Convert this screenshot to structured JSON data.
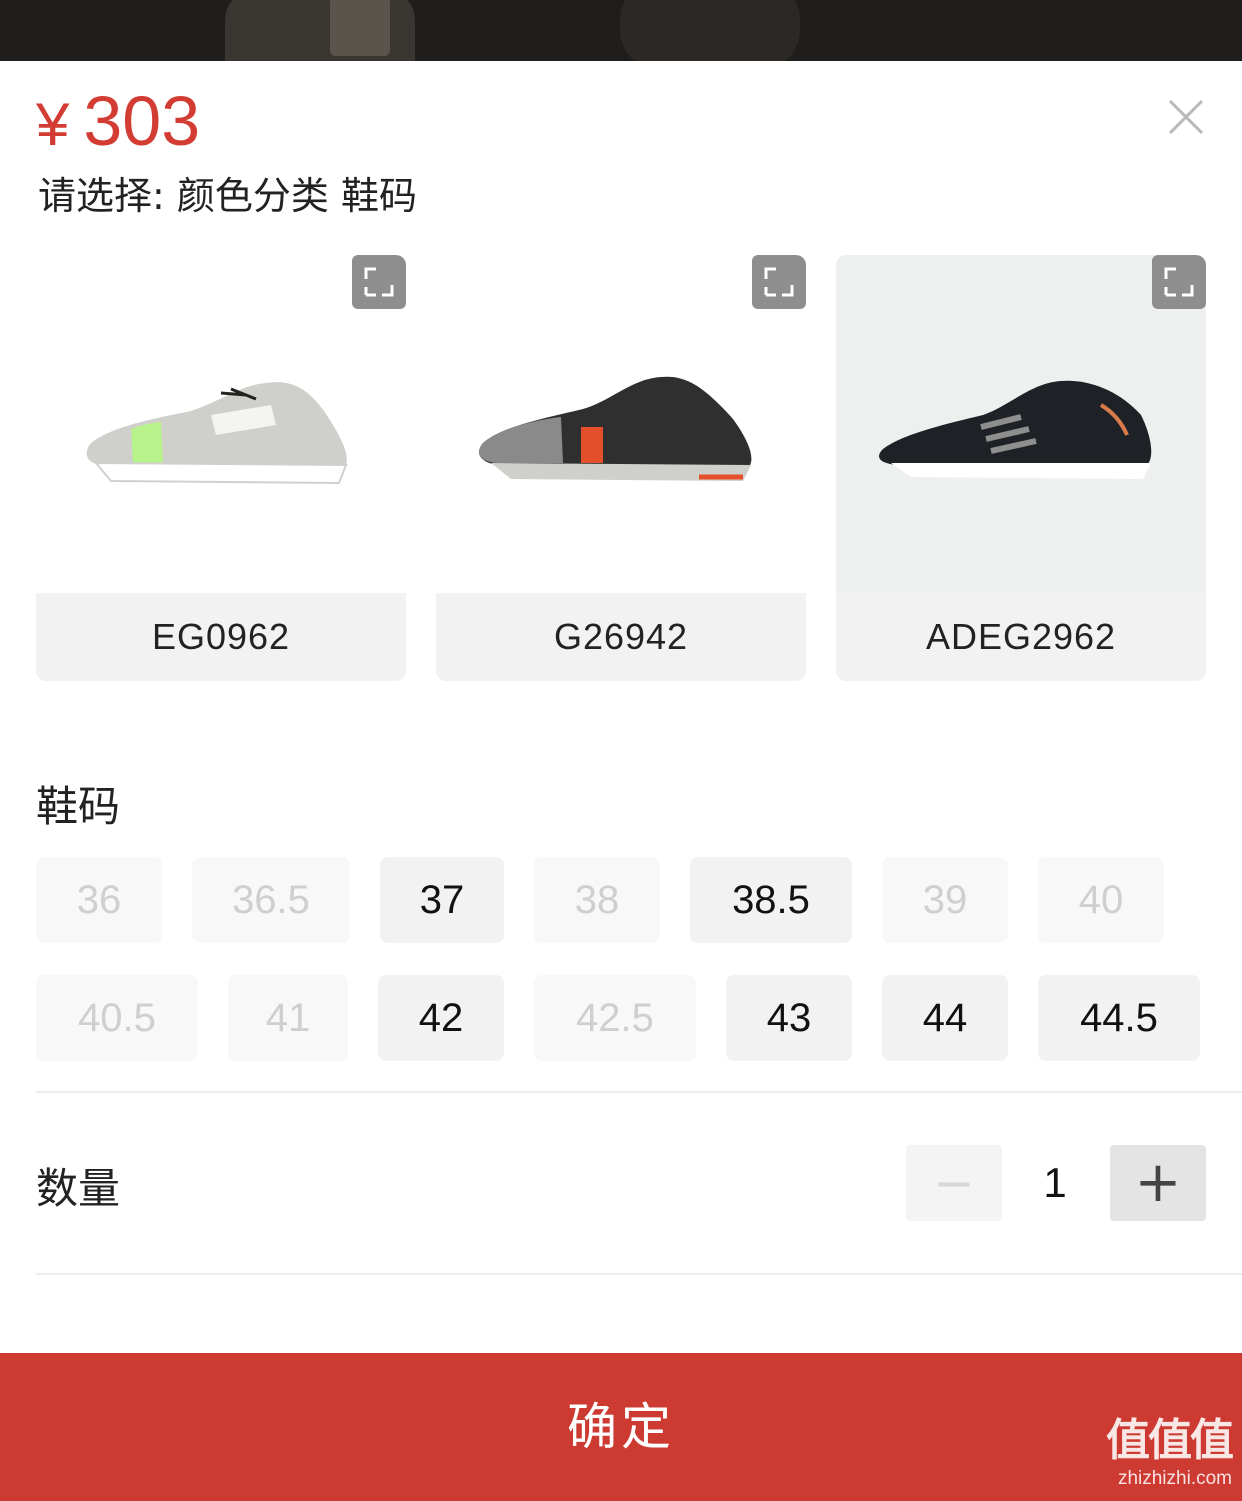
{
  "header": {
    "currency": "¥",
    "price": "303",
    "prompt": "请选择: 颜色分类 鞋码"
  },
  "variants": [
    {
      "label": "EG0962",
      "selected": false,
      "icon": "expand-icon"
    },
    {
      "label": "G26942",
      "selected": false,
      "icon": "expand-icon"
    },
    {
      "label": "ADEG2962",
      "selected": true,
      "icon": "expand-icon"
    }
  ],
  "sizes": {
    "title": "鞋码",
    "options": [
      {
        "label": "36",
        "available": false
      },
      {
        "label": "36.5",
        "available": false
      },
      {
        "label": "37",
        "available": true
      },
      {
        "label": "38",
        "available": false
      },
      {
        "label": "38.5",
        "available": true
      },
      {
        "label": "39",
        "available": false
      },
      {
        "label": "40",
        "available": false
      },
      {
        "label": "40.5",
        "available": false
      },
      {
        "label": "41",
        "available": false
      },
      {
        "label": "42",
        "available": true
      },
      {
        "label": "42.5",
        "available": false
      },
      {
        "label": "43",
        "available": true
      },
      {
        "label": "44",
        "available": true
      },
      {
        "label": "44.5",
        "available": true
      }
    ]
  },
  "quantity": {
    "label": "数量",
    "value": "1",
    "minus": "−",
    "plus": "+"
  },
  "footer": {
    "confirm_label": "确定"
  },
  "watermark": {
    "logo": "值值值",
    "url": "zhizhizhi.com"
  },
  "colors": {
    "accent": "#cc3a32",
    "price": "#d23c32",
    "chip_bg": "#f2f2f2",
    "chip_disabled_text": "#cfcfcf"
  }
}
